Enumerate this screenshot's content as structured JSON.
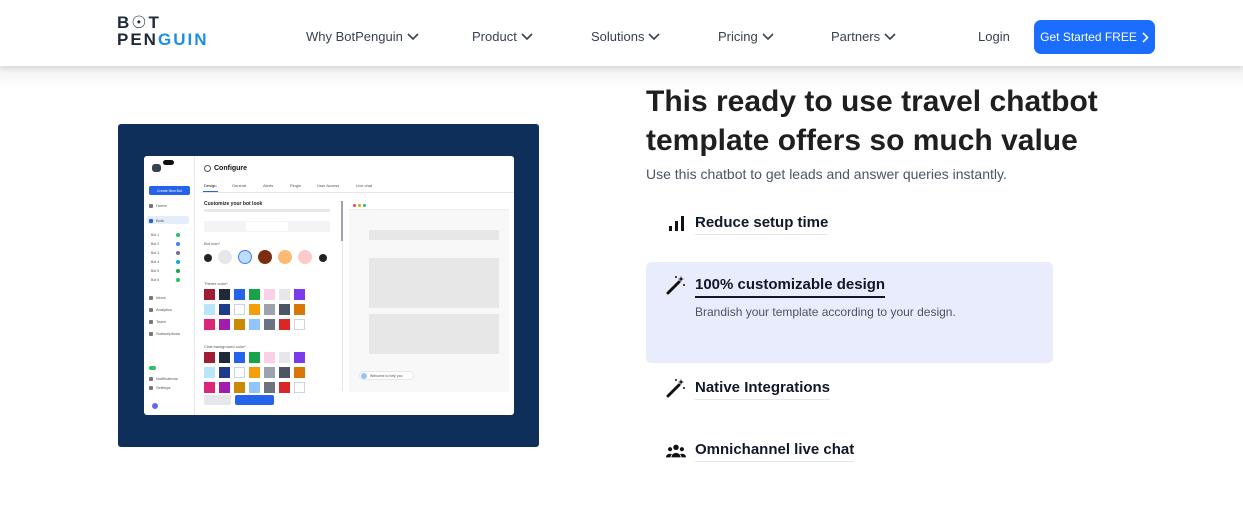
{
  "header": {
    "logo_top": "B☉T",
    "logo_bottom_a": "PEN",
    "logo_bottom_b": "GUIN",
    "nav": [
      {
        "label": "Why BotPenguin"
      },
      {
        "label": "Product"
      },
      {
        "label": "Solutions"
      },
      {
        "label": "Pricing"
      },
      {
        "label": "Partners"
      }
    ],
    "login_label": "Login",
    "cta_label": "Get Started FREE"
  },
  "preview": {
    "configure_title": "Configure",
    "create_bot_label": "Create New Bot",
    "tabs": [
      "Design",
      "General",
      "Alerts",
      "Plugin",
      "User Access",
      "Live chat"
    ],
    "customize_title": "Customize your bot look",
    "bot_icon_label": "Bot icon*",
    "theme_color_label": "Theme color*",
    "chat_bg_label": "Chat background color*",
    "discard_label": "Discard",
    "save_label": "Save Changes",
    "chat_greeting": "Welcome to help you"
  },
  "content": {
    "headline": "This ready to use travel chatbot template offers so much value",
    "subheadline": "Use this chatbot to get leads and answer queries instantly.",
    "features": [
      {
        "title": "Reduce setup time",
        "icon": "bar-chart-icon",
        "active": false
      },
      {
        "title": "100% customizable design",
        "icon": "magic-wand-icon",
        "active": true,
        "description": "Brandish your template according to your design."
      },
      {
        "title": "Native Integrations",
        "icon": "magic-wand-icon",
        "active": false
      },
      {
        "title": "Omnichannel live chat",
        "icon": "users-icon",
        "active": false
      }
    ]
  },
  "colors": {
    "brand_blue": "#1a6dff",
    "preview_bg": "#0e2f59",
    "highlight_bg": "#e8ecfc"
  }
}
